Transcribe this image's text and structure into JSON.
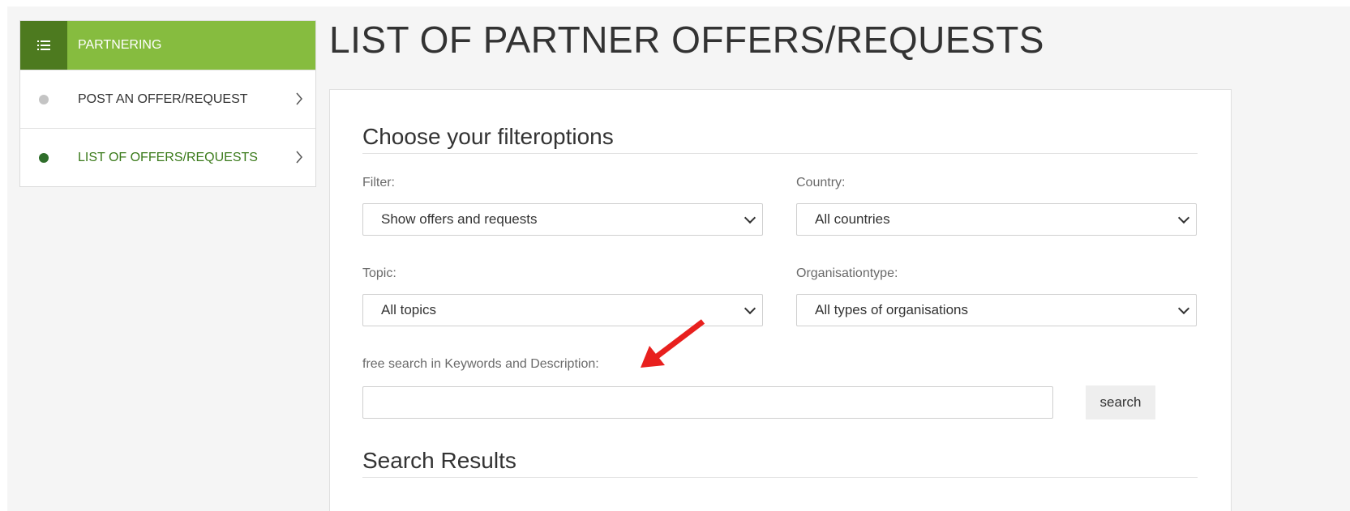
{
  "colors": {
    "sidebar_icon_bg": "#4d7a1f",
    "sidebar_header_bg": "#86bc3f",
    "active_dot": "#2f6e2b",
    "inactive_dot": "#c4c4c4",
    "active_text": "#3a7a1a",
    "arrow": "#e8201e"
  },
  "sidebar": {
    "header": {
      "icon": "list-icon",
      "label": "PARTNERING"
    },
    "items": [
      {
        "label": "POST AN OFFER/REQUEST",
        "active": false,
        "chevron": ">"
      },
      {
        "label": "LIST OF OFFERS/REQUESTS",
        "active": true,
        "chevron": ">"
      }
    ]
  },
  "page": {
    "title": "LIST OF PARTNER OFFERS/REQUESTS"
  },
  "filters": {
    "section_title": "Choose your filteroptions",
    "filter": {
      "label": "Filter:",
      "value": "Show offers and requests"
    },
    "country": {
      "label": "Country:",
      "value": "All countries"
    },
    "topic": {
      "label": "Topic:",
      "value": "All topics"
    },
    "orgtype": {
      "label": "Organisationtype:",
      "value": "All types of organisations"
    },
    "free_search": {
      "label": "free search in Keywords and Description:",
      "value": "",
      "placeholder": ""
    },
    "search_button": "search"
  },
  "results": {
    "section_title": "Search Results"
  }
}
